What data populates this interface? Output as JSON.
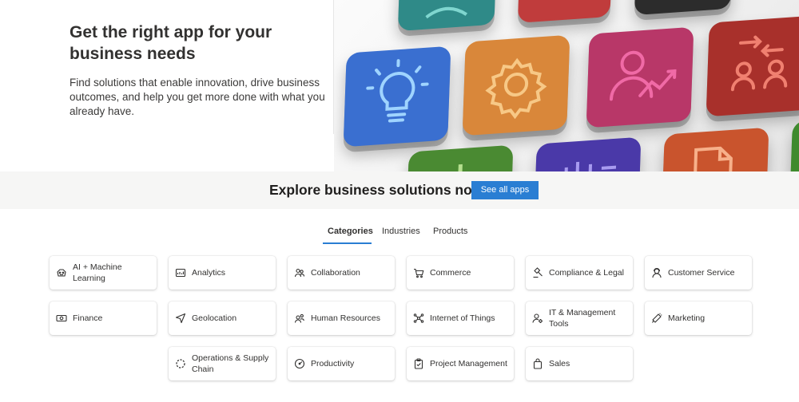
{
  "hero": {
    "title": "Get the right app for your business needs",
    "description": "Find solutions that enable innovation, drive business outcomes, and help you get more done with what you already have."
  },
  "explore": {
    "title": "Explore business solutions now",
    "button_label": "See all apps"
  },
  "tabs": [
    {
      "label": "Categories",
      "active": true
    },
    {
      "label": "Industries",
      "active": false
    },
    {
      "label": "Products",
      "active": false
    }
  ],
  "categories": [
    {
      "label": "AI + Machine Learning",
      "icon": "ai-icon"
    },
    {
      "label": "Analytics",
      "icon": "analytics-icon"
    },
    {
      "label": "Collaboration",
      "icon": "collaboration-icon"
    },
    {
      "label": "Commerce",
      "icon": "cart-icon"
    },
    {
      "label": "Compliance & Legal",
      "icon": "gavel-icon"
    },
    {
      "label": "Customer Service",
      "icon": "customer-icon"
    },
    {
      "label": "Finance",
      "icon": "money-icon"
    },
    {
      "label": "Geolocation",
      "icon": "location-arrow-icon"
    },
    {
      "label": "Human Resources",
      "icon": "people-icon"
    },
    {
      "label": "Internet of Things",
      "icon": "iot-icon"
    },
    {
      "label": "IT & Management Tools",
      "icon": "person-gear-icon"
    },
    {
      "label": "Marketing",
      "icon": "megaphone-icon"
    },
    {
      "label": "Operations & Supply Chain",
      "icon": "cycle-icon"
    },
    {
      "label": "Productivity",
      "icon": "gauge-icon"
    },
    {
      "label": "Project Management",
      "icon": "clipboard-icon"
    },
    {
      "label": "Sales",
      "icon": "bag-icon"
    }
  ],
  "colors": {
    "accent": "#2a7ed3",
    "band": "#f6f6f5",
    "tile_blue": "#3a6fd0",
    "tile_orange": "#d9873a",
    "tile_magenta": "#c43b72",
    "tile_red": "#c0392b",
    "tile_teal": "#2f8a88",
    "tile_green": "#4a8a32",
    "tile_purple": "#5b3fb0"
  },
  "tile_icons": [
    "lightbulb-icon",
    "gear-icon",
    "person-chart-icon",
    "people-transfer-icon",
    "document-icon",
    "chart-bars-icon"
  ]
}
